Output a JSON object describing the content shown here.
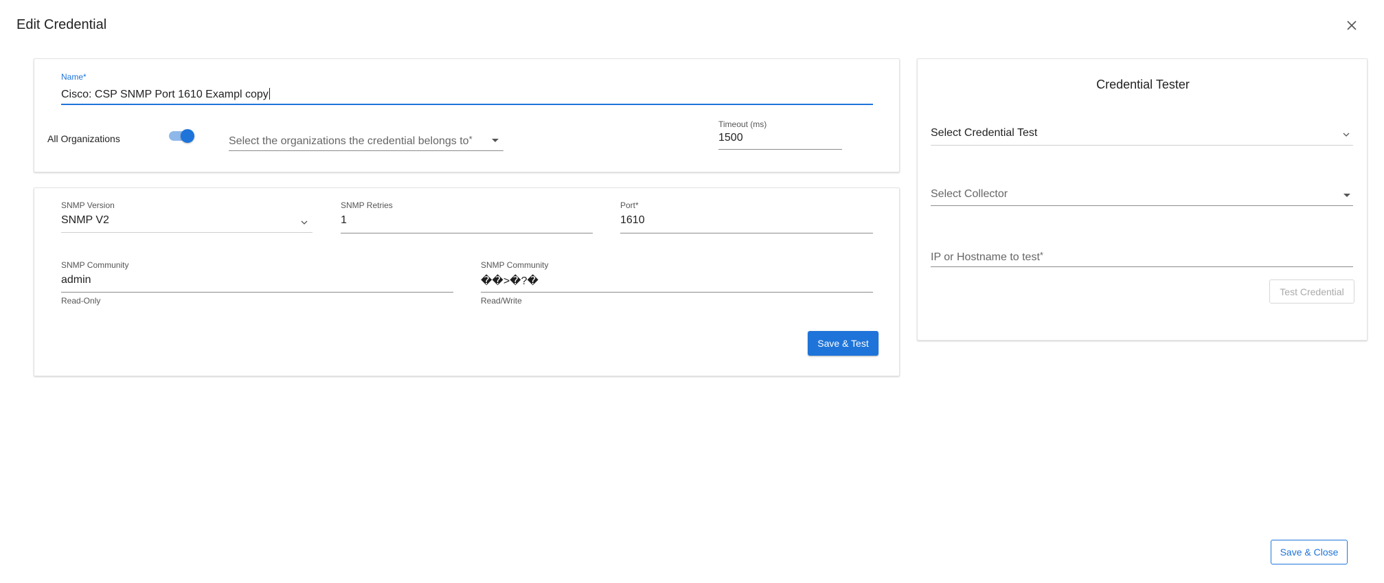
{
  "modal": {
    "title": "Edit Credential",
    "close_icon": "close-icon",
    "save_close_label": "Save & Close"
  },
  "general": {
    "name": {
      "label": "Name",
      "required_mark": "*",
      "value": "Cisco: CSP SNMP Port 1610 Exampl copy"
    },
    "all_organizations": {
      "label": "All Organizations",
      "enabled": true
    },
    "organizations_select": {
      "placeholder": "Select the organizations the credential belongs to",
      "required_mark": "*"
    },
    "timeout": {
      "label": "Timeout (ms)",
      "value": "1500"
    }
  },
  "snmp": {
    "version": {
      "label": "SNMP Version",
      "value": "SNMP V2"
    },
    "retries": {
      "label": "SNMP Retries",
      "value": "1"
    },
    "port": {
      "label": "Port",
      "required_mark": "*",
      "value": "1610"
    },
    "community_ro": {
      "label": "SNMP Community",
      "value": "admin",
      "helper": "Read-Only"
    },
    "community_rw": {
      "label": "SNMP Community",
      "value": "��>�?�",
      "helper": "Read/Write"
    },
    "save_test_label": "Save & Test"
  },
  "tester": {
    "title": "Credential Tester",
    "credential_test": {
      "placeholder": "Select Credential Test"
    },
    "collector": {
      "placeholder": "Select Collector"
    },
    "host": {
      "placeholder": "IP or Hostname to test",
      "required_mark": "*"
    },
    "test_button_label": "Test Credential"
  },
  "colors": {
    "accent": "#1e74d9",
    "toggle_track": "#8fb8ea"
  }
}
